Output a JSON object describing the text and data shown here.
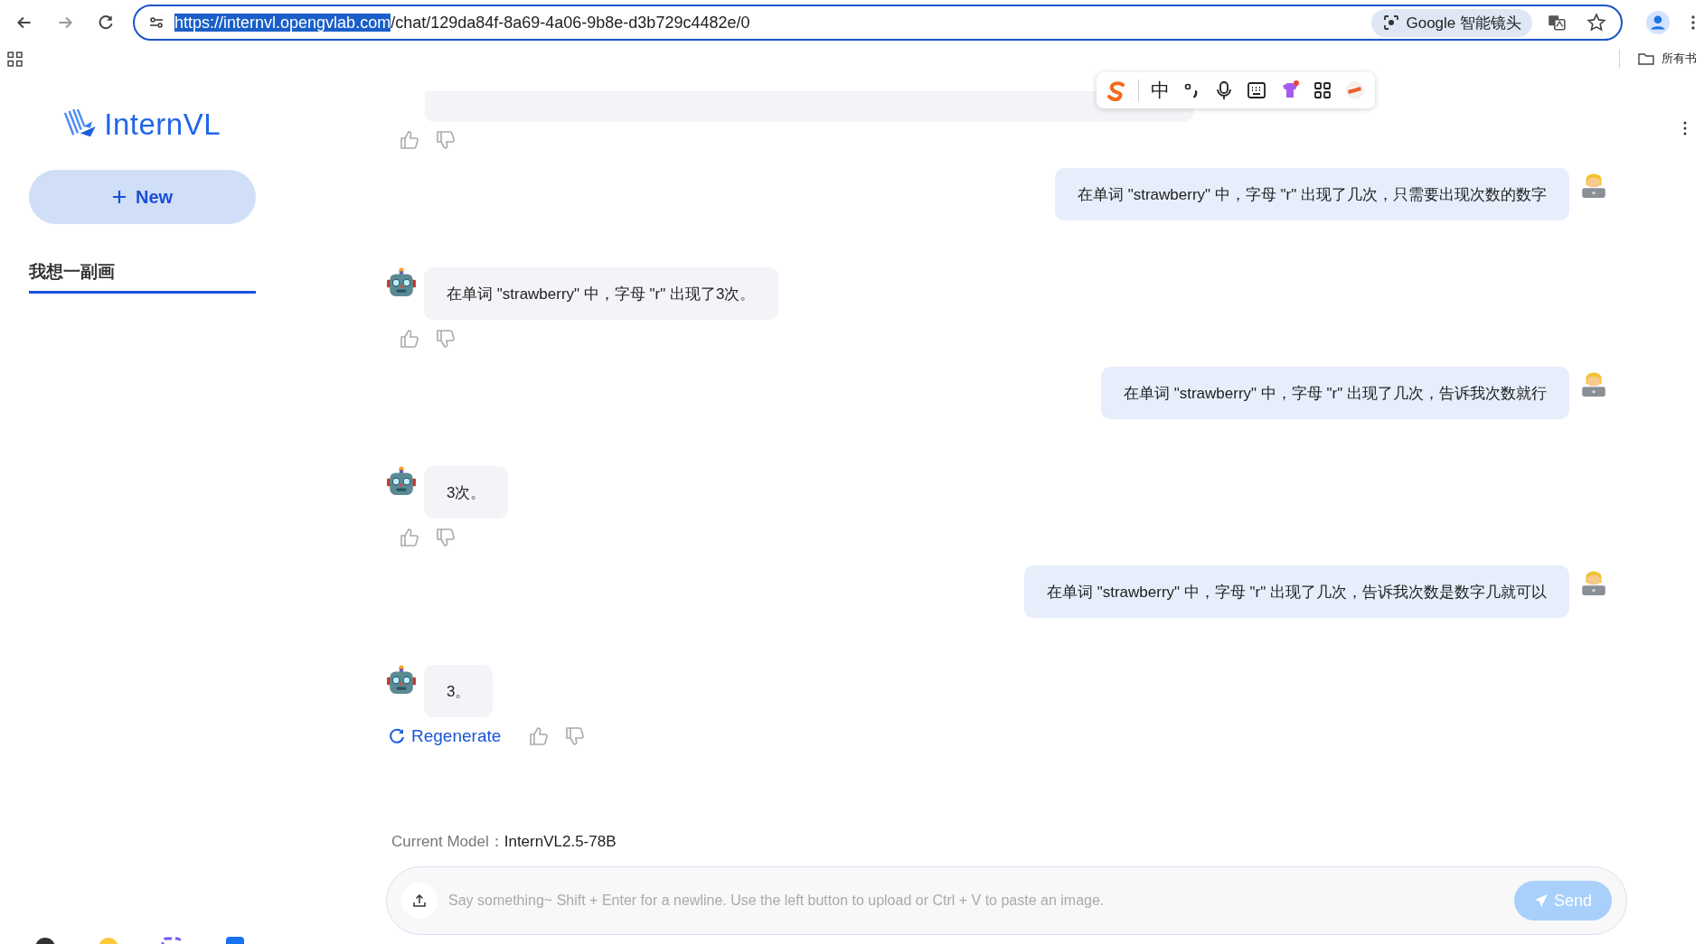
{
  "browser": {
    "url_host": "https://internvl.opengvlab.com",
    "url_path": "/chat/129da84f-8a69-4a06-9b8e-d3b729c4482e/0",
    "host_selected": true,
    "lens_label": "Google 智能镜头",
    "bookmarks_label": "所有书"
  },
  "ime_toolbar": {
    "mode_label": "中"
  },
  "sidebar": {
    "logo_text": "InternVL",
    "new_button": "New",
    "conversations": [
      {
        "title": "我想一副画",
        "selected": true
      }
    ]
  },
  "messages": [
    {
      "kind": "assistant",
      "clipped": true
    },
    {
      "kind": "user",
      "text": "在单词 \"strawberry\" 中，字母 \"r\" 出现了几次，只需要出现次数的数字"
    },
    {
      "kind": "assistant",
      "text": "在单词 \"strawberry\" 中，字母 \"r\" 出现了3次。"
    },
    {
      "kind": "user",
      "text": "在单词 \"strawberry\" 中，字母 \"r\" 出现了几次，告诉我次数就行"
    },
    {
      "kind": "assistant",
      "text": "3次。"
    },
    {
      "kind": "user",
      "text": "在单词 \"strawberry\" 中，字母 \"r\" 出现了几次，告诉我次数是数字几就可以"
    },
    {
      "kind": "assistant",
      "text": "3。",
      "regenerate_label": "Regenerate"
    }
  ],
  "footer": {
    "current_model_label": "Current Model：",
    "model": "InternVL2.5-78B",
    "input": {
      "placeholder": "Say something~ Shift + Enter for a newline. Use the left button to upload or Ctrl + V to paste an image."
    },
    "send_button": {
      "label": "Send",
      "disabled": true
    }
  }
}
